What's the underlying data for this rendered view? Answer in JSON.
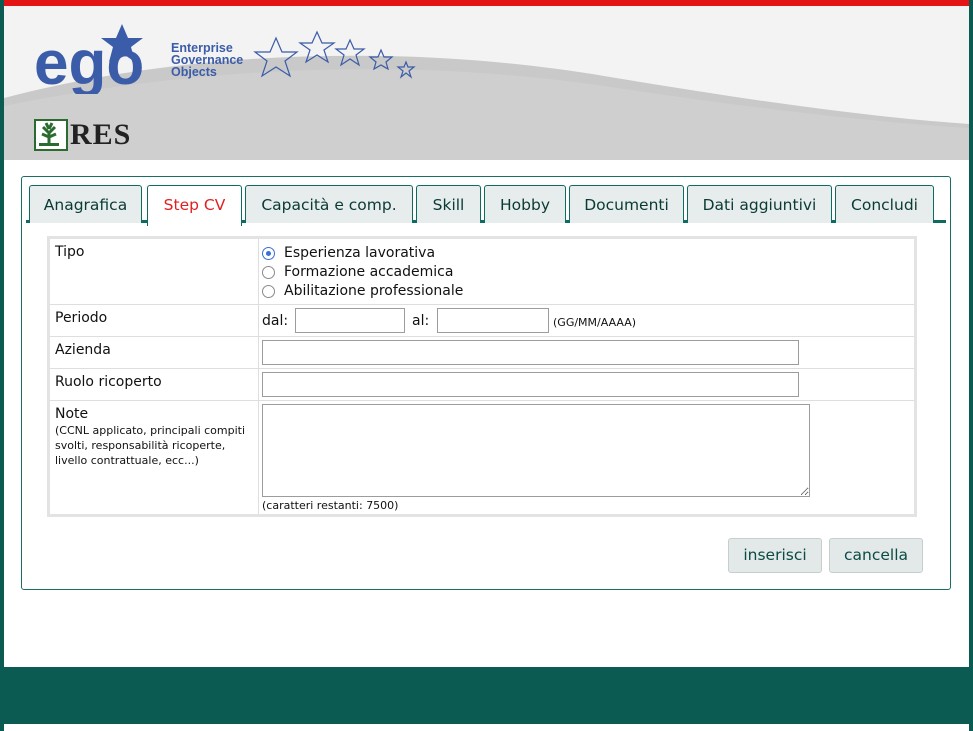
{
  "brand": {
    "logo_text": "ego",
    "tagline_line1": "Enterprise",
    "tagline_line2": "Governance",
    "tagline_line3": "Objects",
    "res_text": "RES"
  },
  "tabs": [
    {
      "label": "Anagrafica",
      "active": false
    },
    {
      "label": "Step CV",
      "active": true
    },
    {
      "label": "Capacità e comp.",
      "active": false
    },
    {
      "label": "Skill",
      "active": false
    },
    {
      "label": "Hobby",
      "active": false
    },
    {
      "label": "Documenti",
      "active": false
    },
    {
      "label": "Dati aggiuntivi",
      "active": false
    },
    {
      "label": "Concludi",
      "active": false
    }
  ],
  "form": {
    "tipo": {
      "label": "Tipo",
      "options": [
        {
          "label": "Esperienza lavorativa",
          "selected": true
        },
        {
          "label": "Formazione accademica",
          "selected": false
        },
        {
          "label": "Abilitazione professionale",
          "selected": false
        }
      ]
    },
    "periodo": {
      "label": "Periodo",
      "from_label": "dal:",
      "to_label": "al:",
      "from_value": "",
      "to_value": "",
      "format_hint": "(GG/MM/AAAA)"
    },
    "azienda": {
      "label": "Azienda",
      "value": ""
    },
    "ruolo": {
      "label": "Ruolo ricoperto",
      "value": ""
    },
    "note": {
      "label": "Note",
      "sublabel": "(CCNL applicato, principali compiti svolti, responsabilità ricoperte, livello contrattuale, ecc...)",
      "value": "",
      "remaining": "(caratteri restanti: 7500)"
    }
  },
  "actions": {
    "insert": "inserisci",
    "cancel": "cancella"
  },
  "colors": {
    "accent_red": "#e31414",
    "brand_teal": "#0b5b52",
    "brand_blue": "#3b5ca8",
    "active_tab_text": "#e02020"
  }
}
